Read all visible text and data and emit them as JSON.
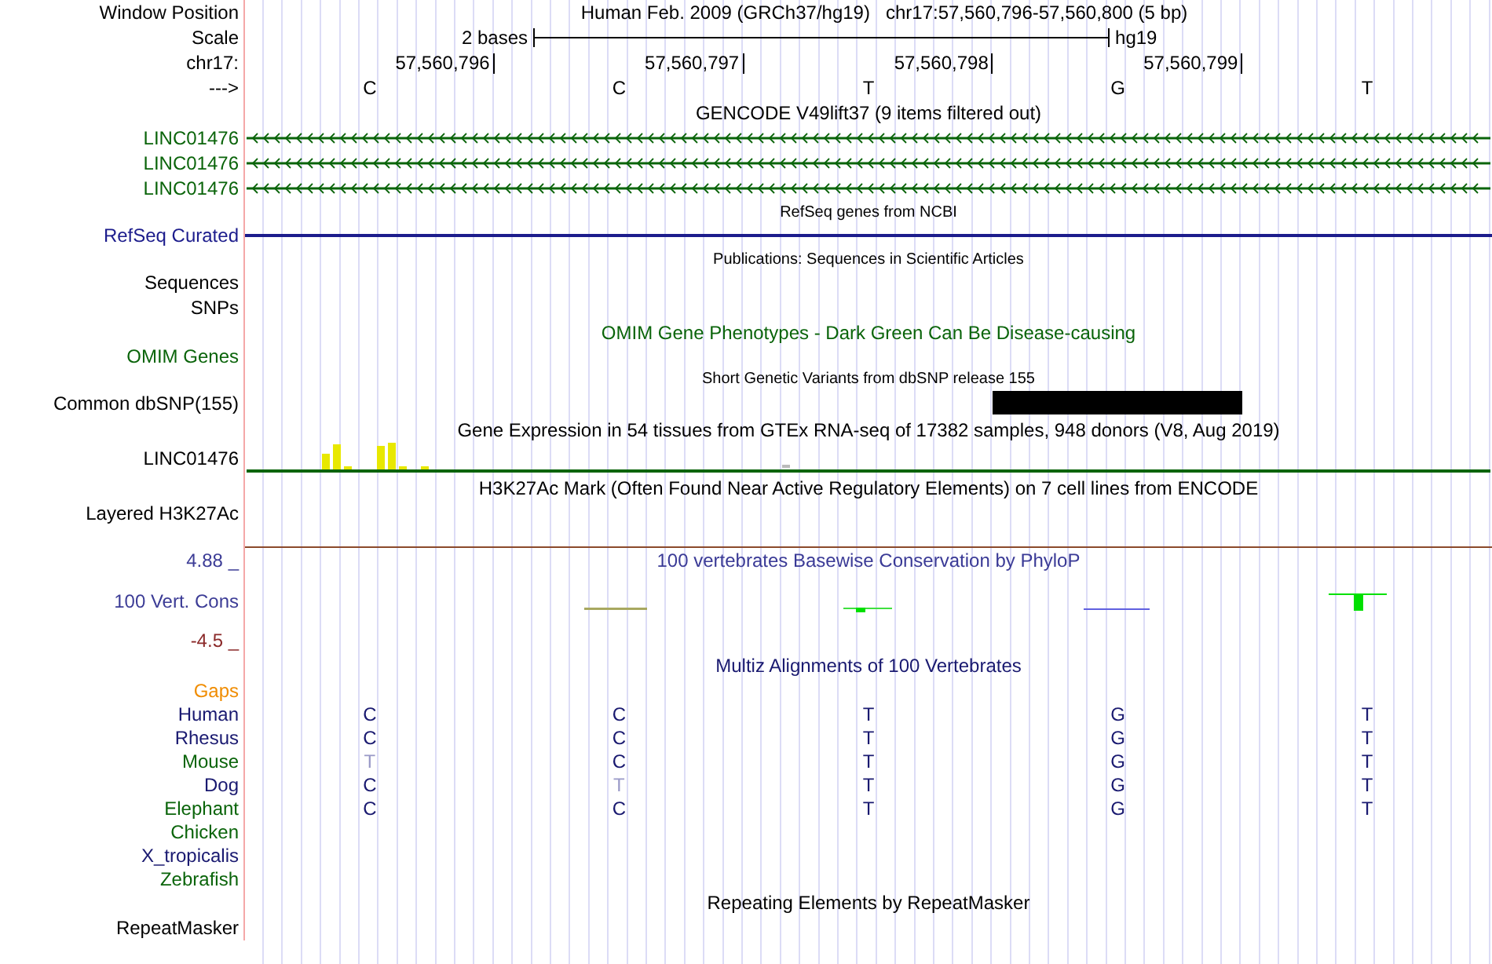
{
  "rows": [
    {
      "kind": "position",
      "label": "Window Position",
      "assembly": "Human Feb. 2009 (GRCh37/hg19)",
      "position": "chr17:57,560,796-57,560,800 (5 bp)"
    },
    {
      "kind": "scale",
      "label": "Scale",
      "text": "2 bases",
      "assembly": "hg19"
    },
    {
      "kind": "ruler",
      "label": "chr17:",
      "ticks": [
        "57,560,796",
        "57,560,797",
        "57,560,798",
        "57,560,799"
      ]
    },
    {
      "kind": "bases",
      "label": "--->",
      "bases": [
        "C",
        "C",
        "T",
        "G",
        "T"
      ]
    },
    {
      "kind": "title",
      "text": "GENCODE V49lift37 (9 items filtered out)",
      "color": "#000000"
    },
    {
      "kind": "gene",
      "label": "LINC01476",
      "color": "#0a640a"
    },
    {
      "kind": "gene",
      "label": "LINC01476",
      "color": "#0a640a"
    },
    {
      "kind": "gene",
      "label": "LINC01476",
      "color": "#0a640a"
    },
    {
      "kind": "subtitle",
      "text": "RefSeq genes from NCBI"
    },
    {
      "kind": "line",
      "label": "RefSeq Curated",
      "color": "#1c1c8c"
    },
    {
      "kind": "subtitle",
      "text": "Publications: Sequences in Scientific Articles"
    },
    {
      "kind": "label",
      "label": "Sequences",
      "color": "#000000"
    },
    {
      "kind": "label",
      "label": "SNPs",
      "color": "#000000"
    },
    {
      "kind": "title",
      "text": "OMIM Gene Phenotypes - Dark Green Can Be Disease-causing",
      "color": "#0a640a"
    },
    {
      "kind": "label",
      "label": "OMIM Genes",
      "color": "#0a640a"
    },
    {
      "kind": "subtitle",
      "text": "Short Genetic Variants from dbSNP release 155"
    },
    {
      "kind": "snp",
      "label": "Common dbSNP(155)"
    },
    {
      "kind": "title",
      "text": "Gene Expression in 54 tissues from GTEx RNA-seq of 17382 samples, 948 donors (V8, Aug 2019)",
      "color": "#000000"
    },
    {
      "kind": "expression",
      "label": "LINC01476"
    },
    {
      "kind": "title",
      "text": "H3K27Ac Mark (Often Found Near Active Regulatory Elements) on 7 cell lines from ENCODE",
      "color": "#000000"
    },
    {
      "kind": "layered",
      "label": "Layered H3K27Ac"
    },
    {
      "kind": "wiggle",
      "title": "100 vertebrates Basewise Conservation by PhyloP",
      "label": "100 Vert. Cons",
      "max": "4.88 _",
      "min": "-4.5 _"
    },
    {
      "kind": "title",
      "text": "Multiz Alignments of 100 Vertebrates",
      "color": "#191970"
    },
    {
      "kind": "alignment",
      "label": "Gaps",
      "color": "#f08c00"
    },
    {
      "kind": "alignment",
      "label": "Human",
      "color": "#191970",
      "bases": [
        {
          "base": "C",
          "differs": false
        },
        {
          "base": "C",
          "differs": false
        },
        {
          "base": "T",
          "differs": false
        },
        {
          "base": "G",
          "differs": false
        },
        {
          "base": "T",
          "differs": false
        }
      ]
    },
    {
      "kind": "alignment",
      "label": "Rhesus",
      "color": "#191970",
      "bases": [
        {
          "base": "C",
          "differs": false
        },
        {
          "base": "C",
          "differs": false
        },
        {
          "base": "T",
          "differs": false
        },
        {
          "base": "G",
          "differs": false
        },
        {
          "base": "T",
          "differs": false
        }
      ]
    },
    {
      "kind": "alignment",
      "label": "Mouse",
      "color": "#0a640a",
      "bases": [
        {
          "base": "T",
          "differs": true
        },
        {
          "base": "C",
          "differs": false
        },
        {
          "base": "T",
          "differs": false
        },
        {
          "base": "G",
          "differs": false
        },
        {
          "base": "T",
          "differs": false
        }
      ]
    },
    {
      "kind": "alignment",
      "label": "Dog",
      "color": "#191970",
      "bases": [
        {
          "base": "C",
          "differs": false
        },
        {
          "base": "T",
          "differs": true
        },
        {
          "base": "T",
          "differs": false
        },
        {
          "base": "G",
          "differs": false
        },
        {
          "base": "T",
          "differs": false
        }
      ]
    },
    {
      "kind": "alignment",
      "label": "Elephant",
      "color": "#0a640a",
      "bases": [
        {
          "base": "C",
          "differs": false
        },
        {
          "base": "C",
          "differs": false
        },
        {
          "base": "T",
          "differs": false
        },
        {
          "base": "G",
          "differs": false
        },
        {
          "base": "T",
          "differs": false
        }
      ]
    },
    {
      "kind": "alignment",
      "label": "Chicken",
      "color": "#0a640a"
    },
    {
      "kind": "alignment",
      "label": "X_tropicalis",
      "color": "#191970"
    },
    {
      "kind": "alignment",
      "label": "Zebrafish",
      "color": "#0a640a"
    },
    {
      "kind": "title",
      "text": "Repeating Elements by RepeatMasker",
      "color": "#000000"
    },
    {
      "kind": "label",
      "label": "RepeatMasker",
      "color": "#000000"
    }
  ]
}
